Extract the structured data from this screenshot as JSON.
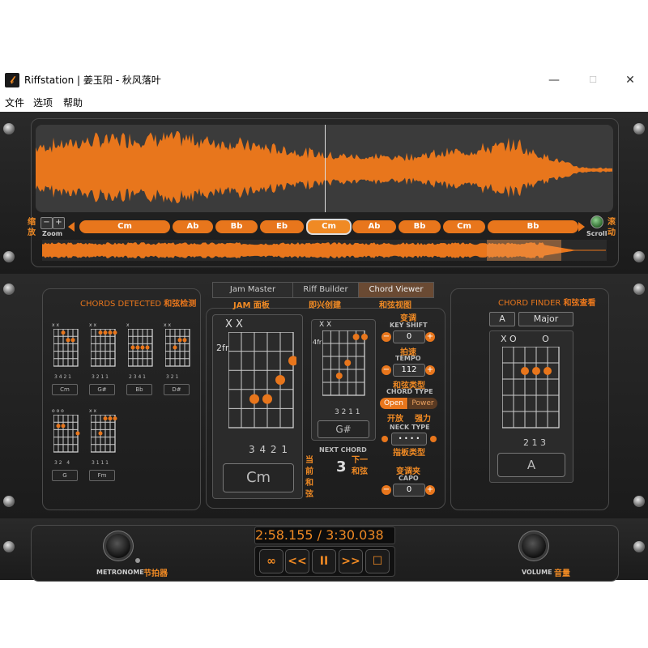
{
  "window": {
    "title": "Riffstation | 姜玉阳 - 秋风落叶",
    "logo": "𝓁",
    "minimize": "—",
    "maximize": "☐",
    "close": "✕"
  },
  "menu": [
    "文件",
    "选项",
    "帮助"
  ],
  "waveform": {
    "zoom_label": "Zoom",
    "zoom_minus": "−",
    "zoom_plus": "+",
    "zoom_cn": [
      "缩",
      "放"
    ],
    "scroll_label": "Scroll",
    "scroll_cn": [
      "滚",
      "动"
    ],
    "chords": [
      "Cm",
      "Ab",
      "Bb",
      "Eb",
      "Cm",
      "Ab",
      "Bb",
      "Cm",
      "Bb"
    ],
    "active_chord_index": 4,
    "accent": "#e8761c"
  },
  "chords_detected": {
    "title": "CHORDS DETECTED",
    "title_cn": "和弦检测",
    "items": [
      {
        "name": "Cm",
        "top": "x x",
        "fingers": "3 4 2 1",
        "fret": "3fr"
      },
      {
        "name": "G#",
        "top": "x x",
        "fingers": "3 2 1 1",
        "fret": "4fr"
      },
      {
        "name": "Bb",
        "top": "x",
        "fingers": "2 3 4 1",
        "fret": ""
      },
      {
        "name": "D#",
        "top": "x x",
        "fingers": "3 2 1",
        "fret": "4fr"
      },
      {
        "name": "G",
        "top": "o o o",
        "fingers": "3 2   4",
        "fret": ""
      },
      {
        "name": "Fm",
        "top": "x x",
        "fingers": "3 1 1 1",
        "fret": ""
      }
    ]
  },
  "tabs": [
    {
      "label": "Jam Master",
      "cn": "JAM 面板"
    },
    {
      "label": "Riff Builder",
      "cn": "即兴创建"
    },
    {
      "label": "Chord Viewer",
      "cn": "和弦视图"
    }
  ],
  "current_chord": {
    "top": "X X",
    "fret": "2fr",
    "fingers": "3 4 2 1",
    "name": "Cm",
    "label_cn": [
      "当",
      "前",
      "和",
      "弦"
    ]
  },
  "next_chord": {
    "top": "X X",
    "fret": "4fr",
    "fingers": "3 2 1 1",
    "name": "G#",
    "label": "NEXT CHORD",
    "count": "3",
    "label_cn": [
      "下一",
      "和弦"
    ]
  },
  "controls": {
    "key_shift": {
      "cn": "变调",
      "label": "KEY SHIFT",
      "value": "0"
    },
    "tempo": {
      "cn": "拍速",
      "label": "TEMPO",
      "value": "112"
    },
    "chord_type": {
      "cn": "和弦类型",
      "label": "CHORD TYPE",
      "open": "Open",
      "power": "Power",
      "open_cn": "开放",
      "power_cn": "强力"
    },
    "neck_type": {
      "label": "NECK TYPE",
      "value": "• • • •",
      "cn": "指板类型"
    },
    "capo": {
      "cn": "变调夹",
      "label": "CAPO",
      "value": "0"
    },
    "minus": "−",
    "plus": "+"
  },
  "chord_finder": {
    "title": "CHORD FINDER",
    "title_cn": "和弦查看",
    "root": "A",
    "quality": "Major",
    "top": "X O         O",
    "fingers": "2 1 3",
    "name": "A"
  },
  "transport": {
    "time": "2:58.155 / 3:30.038",
    "loop": "∞",
    "rewind": "<<",
    "pause": "II",
    "forward": ">>",
    "stop": "☐",
    "metronome": "METRONOME",
    "metronome_cn": "节拍器",
    "volume": "VOLUME",
    "volume_cn": "音量"
  }
}
